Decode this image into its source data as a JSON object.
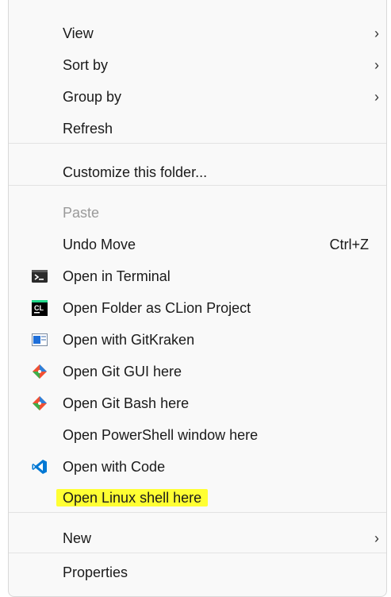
{
  "menu": {
    "groups": {
      "view_group": [
        {
          "label": "View",
          "has_submenu": true
        },
        {
          "label": "Sort by",
          "has_submenu": true
        },
        {
          "label": "Group by",
          "has_submenu": true
        },
        {
          "label": "Refresh",
          "has_submenu": false
        }
      ],
      "customize": {
        "label": "Customize this folder..."
      },
      "actions": [
        {
          "label": "Paste",
          "disabled": true
        },
        {
          "label": "Undo Move",
          "shortcut": "Ctrl+Z"
        },
        {
          "label": "Open in Terminal",
          "icon": "terminal-icon"
        },
        {
          "label": "Open Folder as CLion Project",
          "icon": "clion-icon"
        },
        {
          "label": "Open with GitKraken",
          "icon": "gitkraken-icon"
        },
        {
          "label": "Open Git GUI here",
          "icon": "git-gui-icon"
        },
        {
          "label": "Open Git Bash here",
          "icon": "git-bash-icon"
        },
        {
          "label": "Open PowerShell window here"
        },
        {
          "label": "Open with Code",
          "icon": "vscode-icon"
        },
        {
          "label": "Open Linux shell here",
          "highlighted": true
        }
      ],
      "new": {
        "label": "New",
        "has_submenu": true
      },
      "properties": {
        "label": "Properties"
      }
    },
    "colors": {
      "highlight": "#ffff33",
      "disabled_text": "#9a9a9a",
      "vscode_blue": "#0078d4"
    }
  }
}
